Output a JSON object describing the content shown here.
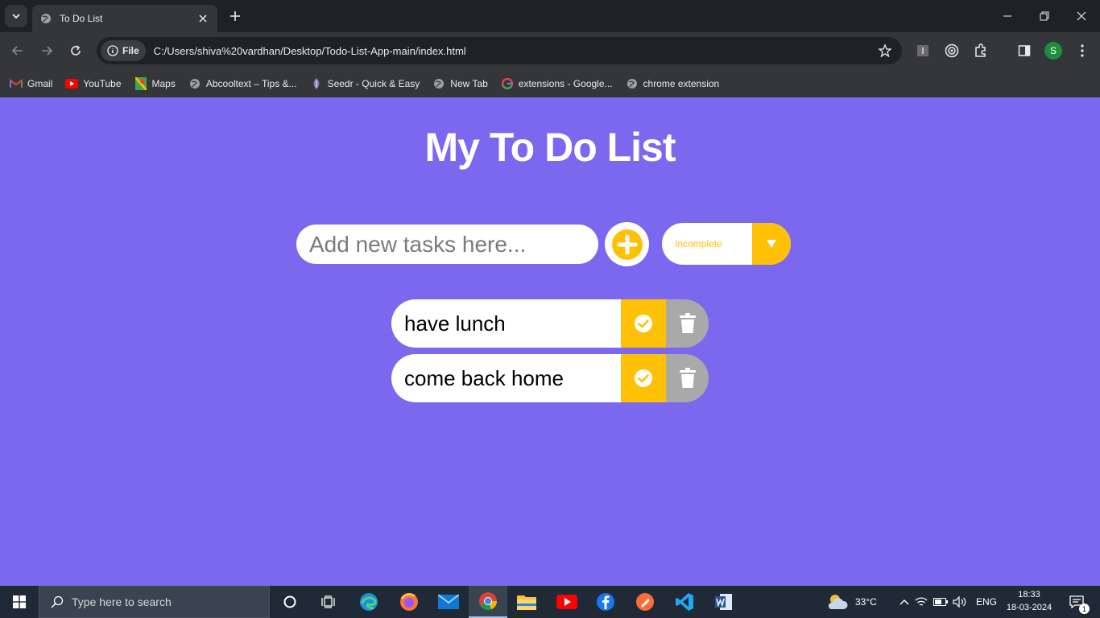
{
  "browser": {
    "tab_title": "To Do List",
    "omnibox_chip": "File",
    "url": "C:/Users/shiva%20vardhan/Desktop/Todo-List-App-main/index.html",
    "profile_initial": "S",
    "bookmarks": [
      {
        "label": "Gmail",
        "icon": "gmail-icon"
      },
      {
        "label": "YouTube",
        "icon": "youtube-icon"
      },
      {
        "label": "Maps",
        "icon": "maps-icon"
      },
      {
        "label": "Abcooltext – Tips &...",
        "icon": "globe-icon"
      },
      {
        "label": "Seedr - Quick & Easy",
        "icon": "seedr-icon"
      },
      {
        "label": "New Tab",
        "icon": "globe-icon"
      },
      {
        "label": "extensions - Google...",
        "icon": "google-icon"
      },
      {
        "label": "chrome extension",
        "icon": "globe-icon"
      }
    ]
  },
  "app": {
    "heading": "My To Do List",
    "input_placeholder": "Add new tasks here...",
    "filter_selected": "Incomplete",
    "todos": [
      {
        "text": "have lunch"
      },
      {
        "text": "come back home"
      }
    ],
    "colors": {
      "background": "#7b68ee",
      "accent": "#ffc107",
      "trash": "#a9a9a9"
    }
  },
  "taskbar": {
    "search_placeholder": "Type here to search",
    "weather": "33°C",
    "language": "ENG",
    "time": "18:33",
    "date": "18-03-2024",
    "notifications": "1"
  }
}
